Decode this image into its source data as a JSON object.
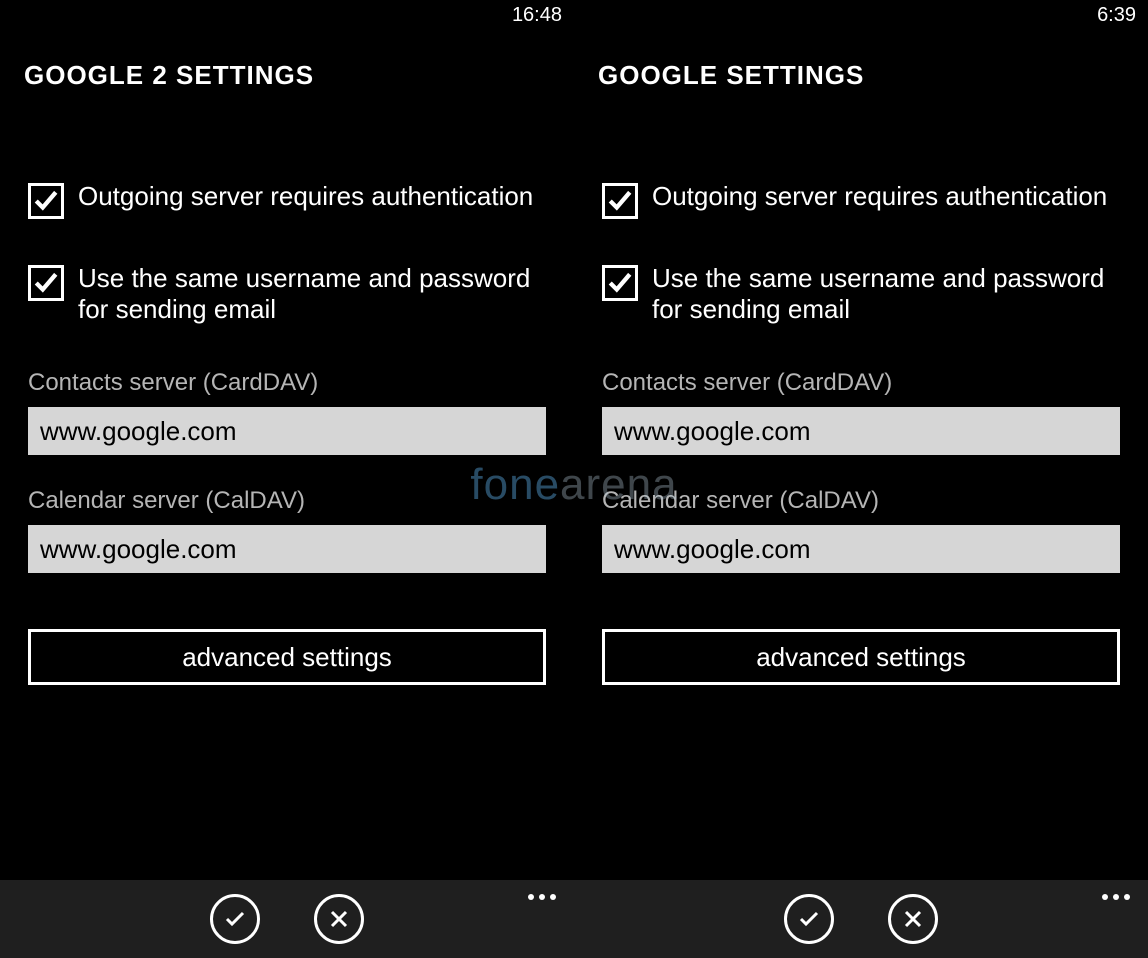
{
  "watermark": {
    "part1": "fone",
    "part2": "arena"
  },
  "panes": [
    {
      "status_time": "16:48",
      "title": "GOOGLE 2 SETTINGS",
      "check1_label": "Outgoing server requires authentication",
      "check2_label": "Use the same username and password for sending email",
      "contacts_label": "Contacts server (CardDAV)",
      "contacts_value": "www.google.com",
      "calendar_label": "Calendar server (CalDAV)",
      "calendar_value": "www.google.com",
      "advanced_label": "advanced settings"
    },
    {
      "status_time": "6:39",
      "title": "GOOGLE SETTINGS",
      "check1_label": "Outgoing server requires authentication",
      "check2_label": "Use the same username and password for sending email",
      "contacts_label": "Contacts server (CardDAV)",
      "contacts_value": "www.google.com",
      "calendar_label": "Calendar server (CalDAV)",
      "calendar_value": "www.google.com",
      "advanced_label": "advanced settings"
    }
  ]
}
